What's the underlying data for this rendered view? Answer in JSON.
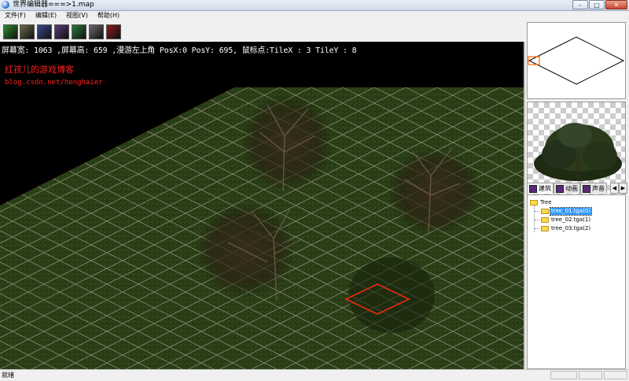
{
  "window": {
    "title": "世界编辑器===>1.map",
    "min": "–",
    "max": "□",
    "close": "✕"
  },
  "menu": [
    "文件(F)",
    "编辑(E)",
    "视图(V)",
    "帮助(H)"
  ],
  "toolbar": [
    {
      "name": "tool-terrain",
      "color": "#2f8a2f"
    },
    {
      "name": "tool-object",
      "color": "#6b6b4a"
    },
    {
      "name": "tool-unit",
      "color": "#3a4a8a"
    },
    {
      "name": "tool-item",
      "color": "#5a3a7a"
    },
    {
      "name": "tool-effect",
      "color": "#2f7a3a"
    },
    {
      "name": "tool-npc",
      "color": "#6a6a6a"
    },
    {
      "name": "tool-monster",
      "color": "#8a1a1a"
    }
  ],
  "viewport": {
    "info": "屏幕宽: 1063 ,屏幕高: 659 ,漫游左上角 PosX:0 PosY: 695, 鼠标点:TileX : 3 TileY : 8",
    "blog_title": "红孩儿的游戏博客",
    "blog_url": "blog.csdn.net/honghaier"
  },
  "panel": {
    "tabs": [
      {
        "label": "建筑",
        "icon": "building-icon"
      },
      {
        "label": "动画",
        "icon": "animation-icon"
      },
      {
        "label": "声音",
        "icon": "sound-icon"
      }
    ],
    "tree": {
      "root": "Tree",
      "items": [
        "tree_01.tga(0)",
        "tree_02.tga(1)",
        "tree_03.tga(2)"
      ],
      "selected_index": 0
    }
  },
  "status": {
    "text": "就绪"
  },
  "colors": {
    "grass": "#2d4219",
    "grid": "#c8c8b4",
    "selection": "#ff2a10",
    "text_red": "#ff2020"
  }
}
